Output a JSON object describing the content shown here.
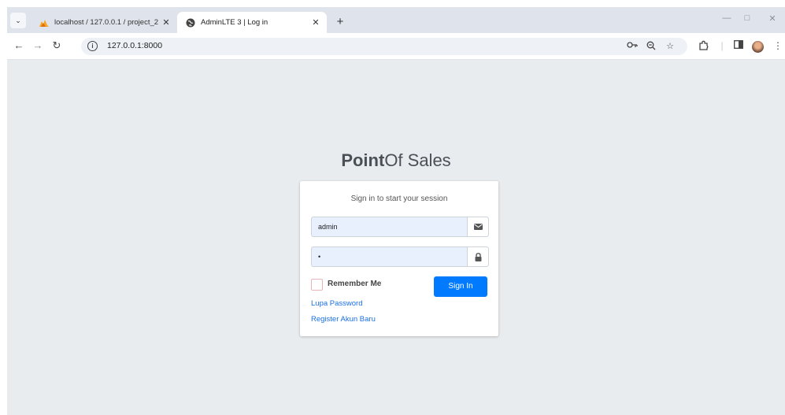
{
  "browser": {
    "tabs": [
      {
        "title": "localhost / 127.0.0.1 / project_2",
        "active": false
      },
      {
        "title": "AdminLTE 3 | Log in",
        "active": true
      }
    ],
    "url": "127.0.0.1:8000"
  },
  "login": {
    "brand_bold": "Point",
    "brand_rest": "Of Sales",
    "message": "Sign in to start your session",
    "username_value": "admin",
    "password_value": "•",
    "remember_label": "Remember Me",
    "signin_label": "Sign In",
    "forgot_link": "Lupa Password",
    "register_link": "Register Akun Baru"
  },
  "colors": {
    "primary": "#007bff",
    "page_bg": "#e9ecef",
    "autofill_bg": "#e8f0fe"
  },
  "icons": [
    "phpmyadmin-icon",
    "globe-icon",
    "envelope-icon",
    "lock-icon",
    "key-icon",
    "zoom-icon",
    "star-icon",
    "extensions-icon",
    "sidepanel-icon"
  ]
}
